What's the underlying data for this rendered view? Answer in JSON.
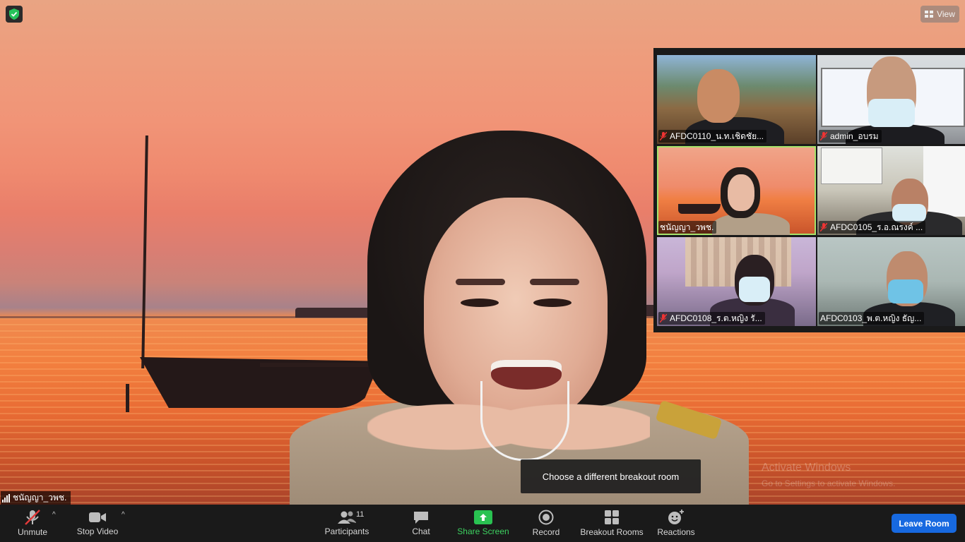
{
  "top": {
    "view_label": "View"
  },
  "gallery": {
    "tiles": [
      {
        "label": "AFDC0110_น.ท.เชิดชัย..."
      },
      {
        "label": "admin_อบรม"
      },
      {
        "label": "ชนัญญา_วพช."
      },
      {
        "label": "AFDC0105_ร.อ.ณรงค์ ..."
      },
      {
        "label": "AFDC0108_ร.ต.หญิง รั..."
      },
      {
        "label": "AFDC0103_พ.ต.หญิง ธัญ..."
      }
    ]
  },
  "main": {
    "self_name": "ชนัญญา_วพช.",
    "tooltip": "Choose a different breakout room",
    "watermark_title": "Activate Windows",
    "watermark_sub": "Go to Settings to activate Windows."
  },
  "toolbar": {
    "unmute": "Unmute",
    "stop_video": "Stop Video",
    "participants": "Participants",
    "participants_count": "11",
    "chat": "Chat",
    "share_screen": "Share Screen",
    "record": "Record",
    "breakout_rooms": "Breakout Rooms",
    "reactions": "Reactions",
    "leave_room": "Leave Room"
  },
  "colors": {
    "toolbar_bg": "#1a1a1a",
    "share_green": "#29c251",
    "leave_blue": "#1769e0",
    "active_speaker": "#a6e36b"
  }
}
